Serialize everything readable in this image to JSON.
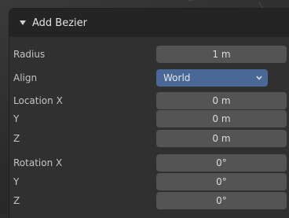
{
  "panel": {
    "title": "Add Bezier",
    "rows": [
      {
        "label": "Radius",
        "value": "1 m"
      },
      {
        "label": "Align",
        "value": "World",
        "type": "select"
      },
      {
        "label": "Location X",
        "value": "0 m"
      },
      {
        "label": "Y",
        "value": "0 m"
      },
      {
        "label": "Z",
        "value": "0 m"
      },
      {
        "label": "Rotation X",
        "value": "0°"
      },
      {
        "label": "Y",
        "value": "0°"
      },
      {
        "label": "Z",
        "value": "0°"
      }
    ]
  },
  "colors": {
    "panel_bg": "#303030",
    "header_bg": "#242424",
    "field_bg": "#545454",
    "select_accent": "#4a6895"
  },
  "icons": {
    "header_toggle": "triangle-down-icon",
    "select_chevron": "chevron-down-icon"
  }
}
